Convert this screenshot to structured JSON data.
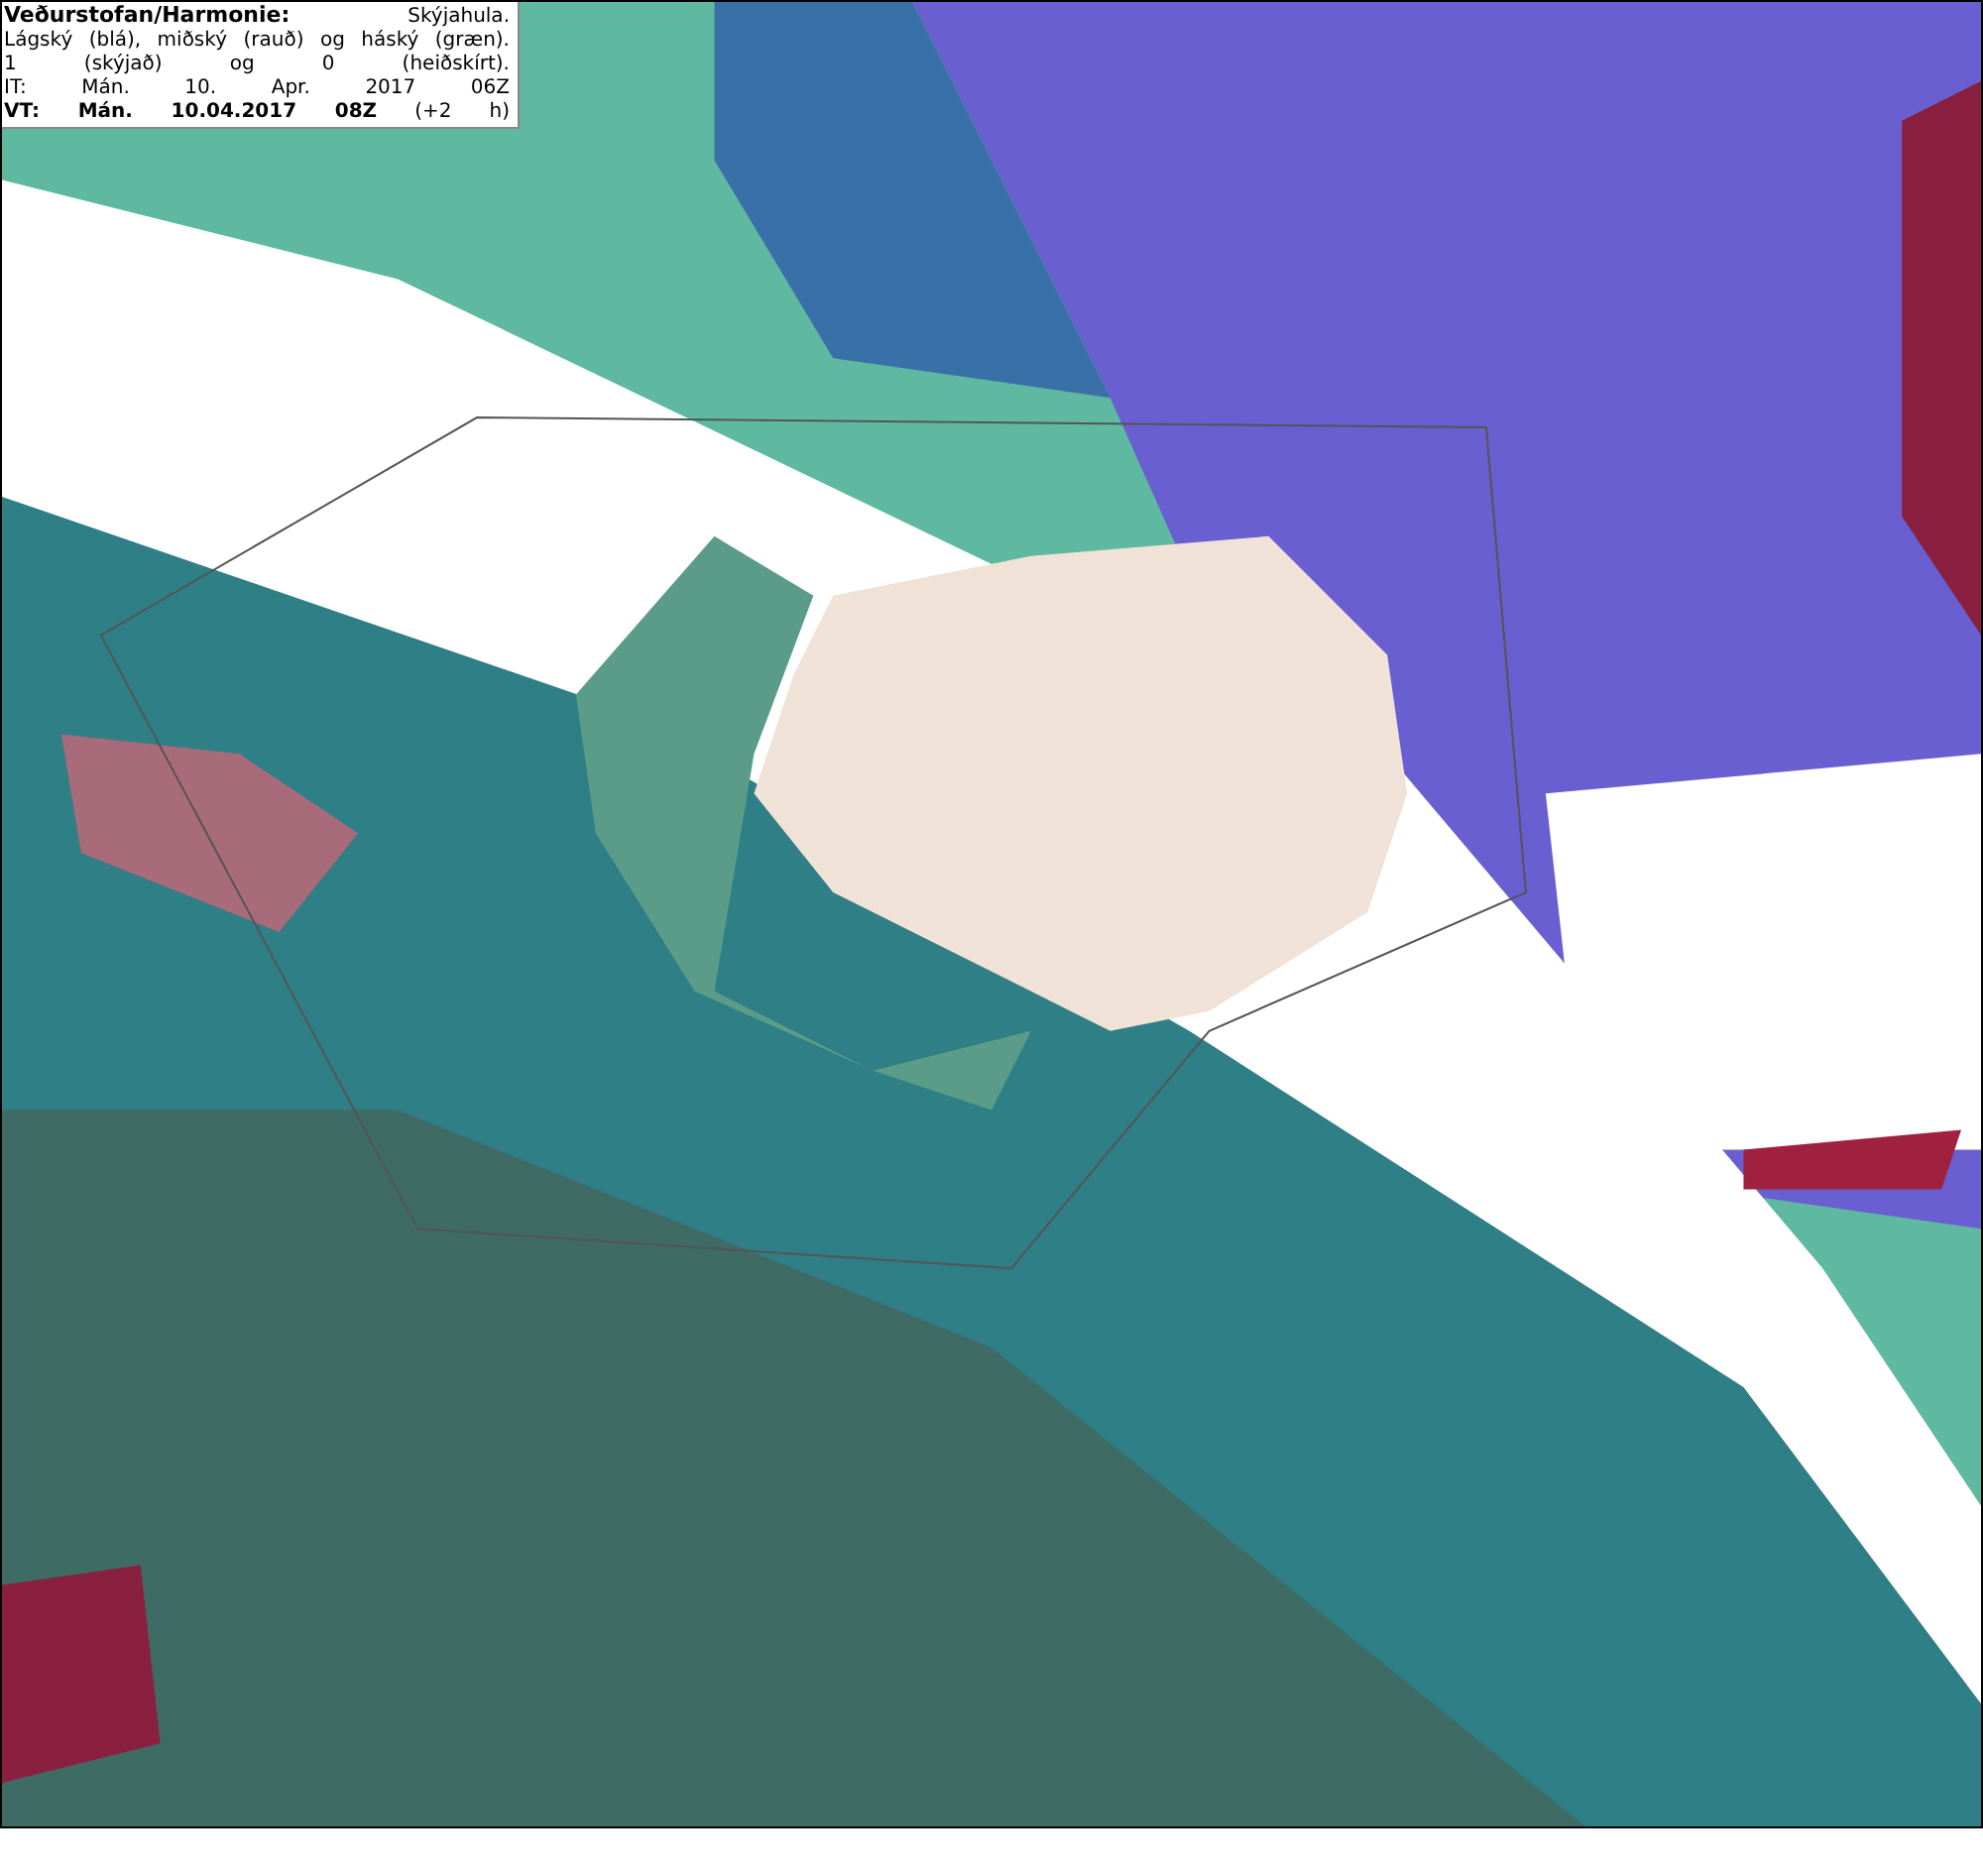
{
  "legend": {
    "title": "Veðurstofan/Harmonie:",
    "subtitle": "Skýjahula.",
    "lines": [
      "Lágský (blá), miðský (rauð) og háský (græn).",
      "1 (skýjað) og 0 (heiðskírt).",
      "IT: Mán. 10. Apr. 2017 06Z",
      "**VT: Mán. 10.04.2017 08Z** (+2 h)"
    ]
  }
}
